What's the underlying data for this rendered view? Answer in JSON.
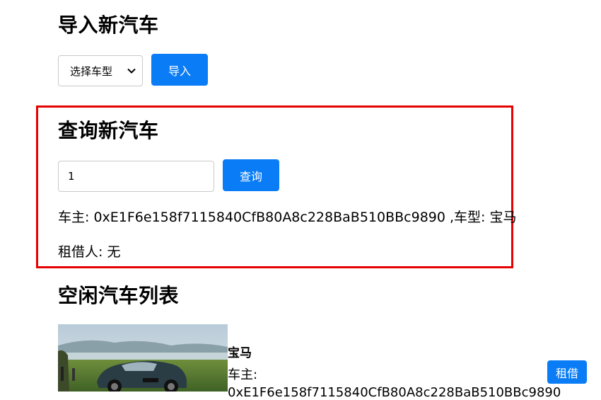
{
  "import_section": {
    "heading": "导入新汽车",
    "select_value": "选择车型",
    "import_button": "导入"
  },
  "query_section": {
    "heading": "查询新汽车",
    "input_value": "1",
    "query_button": "查询",
    "result_line1": "车主: 0xE1F6e158f7115840CfB80A8c228BaB510BBc9890 ,车型: 宝马",
    "result_line2": "租借人: 无"
  },
  "idle_section": {
    "heading": "空闲汽车列表",
    "cars": [
      {
        "model": "宝马",
        "owner_label": "车主:",
        "owner_partial": "0xE1F6e158f7115840CfB80A8c228BaB510BBc9890",
        "rent_button": "租借"
      }
    ]
  },
  "colors": {
    "accent": "#0a7cf5",
    "highlight": "#e60000"
  }
}
